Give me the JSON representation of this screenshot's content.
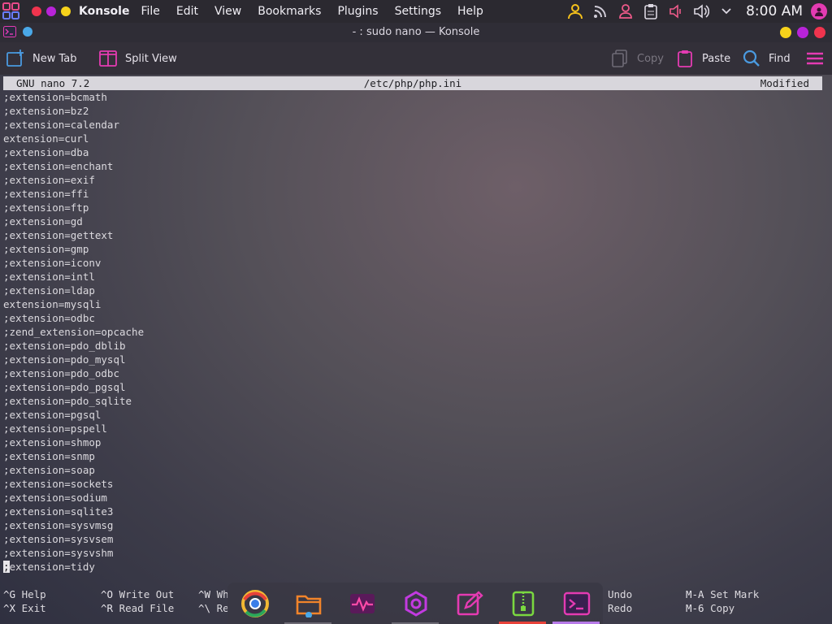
{
  "system_panel": {
    "app_name": "Konsole",
    "menu": [
      "File",
      "Edit",
      "View",
      "Bookmarks",
      "Plugins",
      "Settings",
      "Help"
    ],
    "clock": "8:00 AM",
    "tray_icons": [
      "user-icon",
      "rss-icon",
      "person-icon",
      "clipboard-icon",
      "volume-icon",
      "speaker-icon",
      "chevron-down-icon"
    ]
  },
  "window": {
    "title": "- : sudo nano — Konsole"
  },
  "toolbar": {
    "new_tab": "New Tab",
    "split_view": "Split View",
    "copy": "Copy",
    "paste": "Paste",
    "find": "Find"
  },
  "nano": {
    "version": "GNU nano 7.2",
    "file": "/etc/php/php.ini",
    "status": "Modified",
    "lines": [
      ";extension=bcmath",
      ";extension=bz2",
      ";extension=calendar",
      "extension=curl",
      ";extension=dba",
      ";extension=enchant",
      ";extension=exif",
      ";extension=ffi",
      ";extension=ftp",
      ";extension=gd",
      ";extension=gettext",
      ";extension=gmp",
      ";extension=iconv",
      ";extension=intl",
      ";extension=ldap",
      "extension=mysqli",
      ";extension=odbc",
      ";zend_extension=opcache",
      ";extension=pdo_dblib",
      ";extension=pdo_mysql",
      ";extension=pdo_odbc",
      ";extension=pdo_pgsql",
      ";extension=pdo_sqlite",
      ";extension=pgsql",
      ";extension=pspell",
      ";extension=shmop",
      ";extension=snmp",
      ";extension=soap",
      ";extension=sockets",
      ";extension=sodium",
      ";extension=sqlite3",
      ";extension=sysvmsg",
      ";extension=sysvsem",
      ";extension=sysvshm",
      ";extension=tidy"
    ],
    "shortcuts": {
      "help_key": "^G",
      "help": "Help",
      "exit_key": "^X",
      "exit": "Exit",
      "writeout_key": "^O",
      "writeout": "Write Out",
      "readfile_key": "^R",
      "readfile": "Read File",
      "where_key": "^W",
      "where": "Wh",
      "replace_key": "^\\",
      "replace": "Re",
      "undo_key": "",
      "undo": "Undo",
      "redo_key": "",
      "redo": "Redo",
      "setmark_key": "M-A",
      "setmark": "Set Mark",
      "copy_key": "M-6",
      "copy": "Copy"
    }
  },
  "dock": {
    "apps": [
      "chrome-icon",
      "file-manager-icon",
      "system-monitor-icon",
      "settings-icon",
      "text-editor-icon",
      "archive-icon",
      "terminal-icon"
    ]
  }
}
